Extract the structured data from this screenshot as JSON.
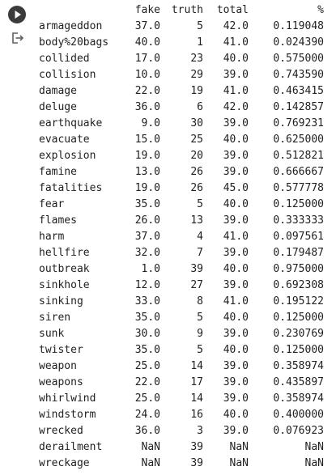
{
  "columns": [
    "",
    "fake",
    "truth",
    "total",
    "%"
  ],
  "rows": [
    [
      "armageddon",
      "37.0",
      "5",
      "42.0",
      "0.119048"
    ],
    [
      "body%20bags",
      "40.0",
      "1",
      "41.0",
      "0.024390"
    ],
    [
      "collided",
      "17.0",
      "23",
      "40.0",
      "0.575000"
    ],
    [
      "collision",
      "10.0",
      "29",
      "39.0",
      "0.743590"
    ],
    [
      "damage",
      "22.0",
      "19",
      "41.0",
      "0.463415"
    ],
    [
      "deluge",
      "36.0",
      "6",
      "42.0",
      "0.142857"
    ],
    [
      "earthquake",
      "9.0",
      "30",
      "39.0",
      "0.769231"
    ],
    [
      "evacuate",
      "15.0",
      "25",
      "40.0",
      "0.625000"
    ],
    [
      "explosion",
      "19.0",
      "20",
      "39.0",
      "0.512821"
    ],
    [
      "famine",
      "13.0",
      "26",
      "39.0",
      "0.666667"
    ],
    [
      "fatalities",
      "19.0",
      "26",
      "45.0",
      "0.577778"
    ],
    [
      "fear",
      "35.0",
      "5",
      "40.0",
      "0.125000"
    ],
    [
      "flames",
      "26.0",
      "13",
      "39.0",
      "0.333333"
    ],
    [
      "harm",
      "37.0",
      "4",
      "41.0",
      "0.097561"
    ],
    [
      "hellfire",
      "32.0",
      "7",
      "39.0",
      "0.179487"
    ],
    [
      "outbreak",
      "1.0",
      "39",
      "40.0",
      "0.975000"
    ],
    [
      "sinkhole",
      "12.0",
      "27",
      "39.0",
      "0.692308"
    ],
    [
      "sinking",
      "33.0",
      "8",
      "41.0",
      "0.195122"
    ],
    [
      "siren",
      "35.0",
      "5",
      "40.0",
      "0.125000"
    ],
    [
      "sunk",
      "30.0",
      "9",
      "39.0",
      "0.230769"
    ],
    [
      "twister",
      "35.0",
      "5",
      "40.0",
      "0.125000"
    ],
    [
      "weapon",
      "25.0",
      "14",
      "39.0",
      "0.358974"
    ],
    [
      "weapons",
      "22.0",
      "17",
      "39.0",
      "0.435897"
    ],
    [
      "whirlwind",
      "25.0",
      "14",
      "39.0",
      "0.358974"
    ],
    [
      "windstorm",
      "24.0",
      "16",
      "40.0",
      "0.400000"
    ],
    [
      "wrecked",
      "36.0",
      "3",
      "39.0",
      "0.076923"
    ],
    [
      "derailment",
      "NaN",
      "39",
      "NaN",
      "NaN"
    ],
    [
      "wreckage",
      "NaN",
      "39",
      "NaN",
      "NaN"
    ]
  ],
  "icons": {
    "run": "play-circle-icon",
    "output": "output-redirect-icon"
  },
  "colors": {
    "text": "#212121",
    "run_button": "#3b3b3b",
    "icon": "#616161"
  }
}
